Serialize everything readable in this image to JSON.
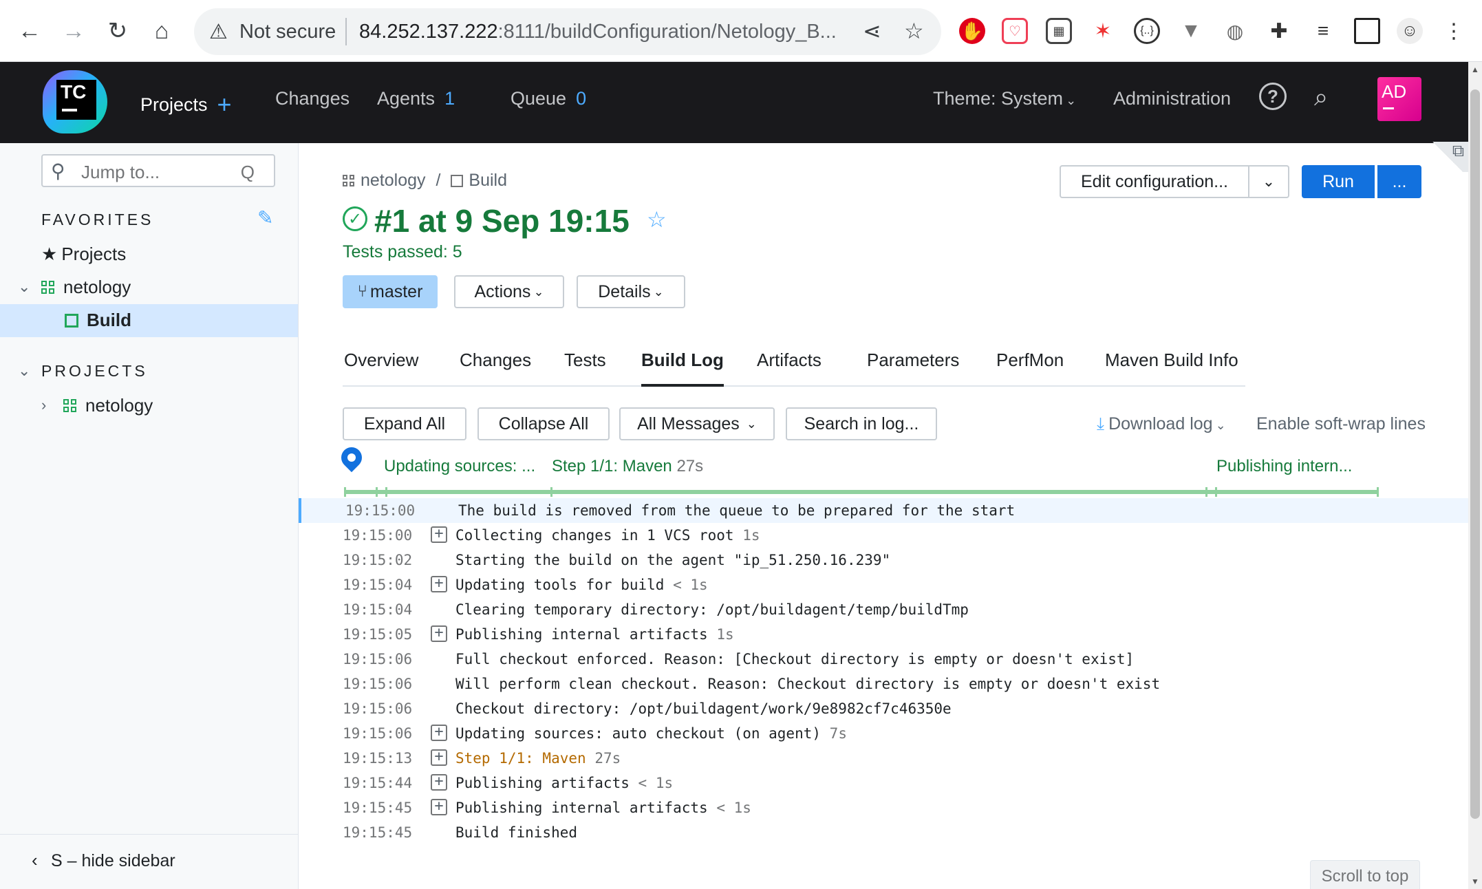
{
  "browser": {
    "security_text": "Not secure",
    "url_host": "84.252.137.222",
    "url_rest": ":8111/buildConfiguration/Netology_B..."
  },
  "header": {
    "nav": {
      "projects": "Projects",
      "changes": "Changes",
      "agents": "Agents",
      "agents_count": "1",
      "queue": "Queue",
      "queue_count": "0",
      "theme": "Theme: System",
      "administration": "Administration"
    },
    "avatar_initials": "AD",
    "logo_text": "TC"
  },
  "sidebar": {
    "search_placeholder": "Jump to...",
    "search_shortcut": "Q",
    "favorites_title": "FAVORITES",
    "favorites": {
      "projects": "Projects",
      "netology": "netology",
      "build": "Build"
    },
    "projects_title": "PROJECTS",
    "projects_item": "netology",
    "hide_sidebar": "S – hide sidebar"
  },
  "main": {
    "breadcrumb_project": "netology",
    "breadcrumb_sep": "/",
    "breadcrumb_build": "Build",
    "build_title": "#1 at 9 Sep 19:15",
    "tests_passed": "Tests passed: 5",
    "branch": "master",
    "actions": "Actions",
    "details": "Details",
    "edit_configuration": "Edit configuration...",
    "run": "Run",
    "run_more": "...",
    "tabs": [
      "Overview",
      "Changes",
      "Tests",
      "Build Log",
      "Artifacts",
      "Parameters",
      "PerfMon",
      "Maven Build Info"
    ],
    "active_tab": "Build Log",
    "toolbar": {
      "expand_all": "Expand All",
      "collapse_all": "Collapse All",
      "all_messages": "All Messages",
      "search_in_log": "Search in log...",
      "download_log": "Download log",
      "soft_wrap": "Enable soft-wrap lines"
    },
    "timeline": {
      "updating_sources": "Updating sources: ...",
      "step": "Step 1/1: Maven",
      "step_duration": "27s",
      "publishing": "Publishing intern..."
    },
    "scroll_to_top": "Scroll to top"
  },
  "log": [
    {
      "time": "19:15:00",
      "expandable": false,
      "text": "The build is removed from the queue to be prepared for the start",
      "duration": ""
    },
    {
      "time": "19:15:00",
      "expandable": true,
      "text": "Collecting changes in 1 VCS root",
      "duration": "1s"
    },
    {
      "time": "19:15:02",
      "expandable": false,
      "text": "Starting the build on the agent \"ip_51.250.16.239\"",
      "duration": ""
    },
    {
      "time": "19:15:04",
      "expandable": true,
      "text": "Updating tools for build",
      "duration": "< 1s"
    },
    {
      "time": "19:15:04",
      "expandable": false,
      "text": "Clearing temporary directory: /opt/buildagent/temp/buildTmp",
      "duration": ""
    },
    {
      "time": "19:15:05",
      "expandable": true,
      "text": "Publishing internal artifacts",
      "duration": "1s"
    },
    {
      "time": "19:15:06",
      "expandable": false,
      "text": "Full checkout enforced. Reason: [Checkout directory is empty or doesn't exist]",
      "duration": ""
    },
    {
      "time": "19:15:06",
      "expandable": false,
      "text": "Will perform clean checkout. Reason: Checkout directory is empty or doesn't exist",
      "duration": ""
    },
    {
      "time": "19:15:06",
      "expandable": false,
      "text": "Checkout directory: /opt/buildagent/work/9e8982cf7c46350e",
      "duration": ""
    },
    {
      "time": "19:15:06",
      "expandable": true,
      "text": "Updating sources: auto checkout (on agent)",
      "duration": "7s"
    },
    {
      "time": "19:15:13",
      "expandable": true,
      "text": "Step 1/1: Maven",
      "duration": "27s",
      "style": "step"
    },
    {
      "time": "19:15:44",
      "expandable": true,
      "text": "Publishing artifacts",
      "duration": "< 1s"
    },
    {
      "time": "19:15:45",
      "expandable": true,
      "text": "Publishing internal artifacts",
      "duration": "< 1s"
    },
    {
      "time": "19:15:45",
      "expandable": false,
      "text": "Build finished",
      "duration": ""
    }
  ]
}
